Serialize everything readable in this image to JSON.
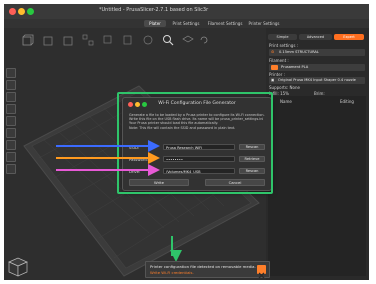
{
  "window": {
    "title": "*Untitled - PrusaSlicer-2.7.1 based on Slic3r"
  },
  "tabs": [
    {
      "label": "Plater",
      "active": true
    },
    {
      "label": "Print Settings"
    },
    {
      "label": "Filament Settings"
    },
    {
      "label": "Printer Settings"
    }
  ],
  "sidebar": {
    "modes": {
      "simple": "Simple",
      "advanced": "Advanced",
      "expert": "Expert"
    },
    "print_settings_label": "Print settings :",
    "print_settings_value": "0.15mm STRUCTURAL",
    "filament_label": "Filament :",
    "filament_value": "Prusament PLA",
    "printer_label": "Printer :",
    "printer_value": "Original Prusa MK4 Input Shaper 0.4 nozzle",
    "supports_label": "Supports: None",
    "infill_label": "Infill: 15%",
    "brim_label": "Brim:",
    "list_header_name": "Name",
    "list_header_editing": "Editing"
  },
  "dialog": {
    "title": "Wi-Fi Configuration File Generator",
    "description": [
      "Generate a file to be loaded by a Prusa printer to configure its Wi-Fi connection.",
      "Write this file on the USB flash drive. Its name will be prusa_printer_settings.ini",
      "Your Prusa printer should load this file automatically.",
      "Note: This file will contain the SSID and password in plain text."
    ],
    "fields": [
      {
        "label": "SSID:",
        "value": "Prusa Research WiFi",
        "button": "Rescan"
      },
      {
        "label": "Password:",
        "value": "••••••••",
        "button": "Retrieve"
      },
      {
        "label": "Drive:",
        "value": "/Volumes/MK4_USB",
        "button": "Rescan"
      }
    ],
    "write_button": "Write",
    "cancel_button": "Cancel"
  },
  "notification": {
    "text": "Printer configuration file detected on removable media.",
    "link": "Write Wi-Fi credentials."
  },
  "colors": {
    "accent": "#ff7f2a",
    "highlight": "#2fc46a",
    "arrow_ssid": "#3b6bff",
    "arrow_password": "#ff9a1f",
    "arrow_drive": "#e85ad6",
    "arrow_notification": "#2fc46a"
  },
  "icons": {
    "close": "close-icon",
    "gear": "gear-icon",
    "cube": "cube-icon"
  }
}
